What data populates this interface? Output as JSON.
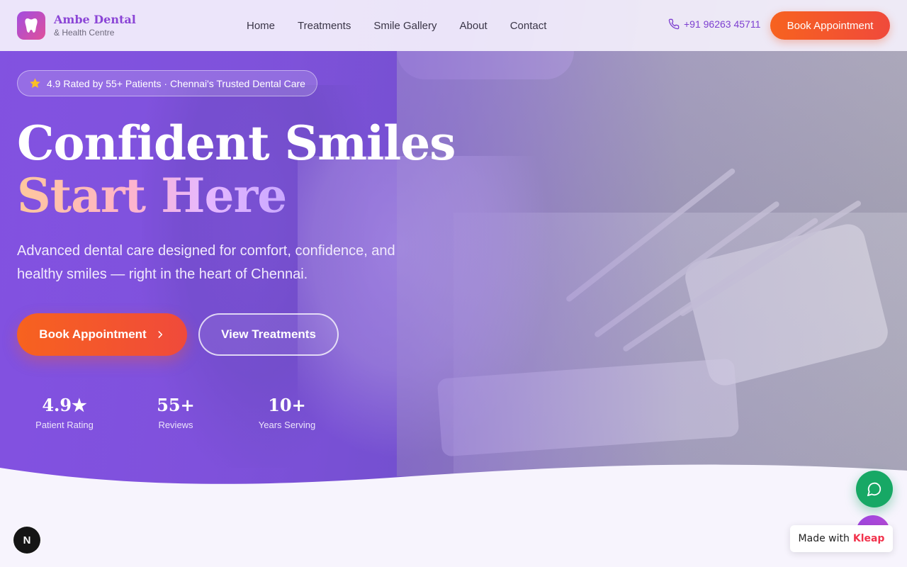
{
  "brand": {
    "name": "Ambe Dental",
    "subtitle": "& Health Centre",
    "accent": "#8b45d6",
    "cta_color": "#f7621f"
  },
  "nav": {
    "links": [
      "Home",
      "Treatments",
      "Smile Gallery",
      "About",
      "Contact"
    ],
    "phone": "+91 96263 45711",
    "cta": "Book Appointment"
  },
  "hero": {
    "rating_pill": "4.9 Rated by 55+ Patients · Chennai's Trusted Dental Care",
    "headline_line1": "Confident Smiles",
    "headline_line2": "Start Here",
    "lead": "Advanced dental care designed for comfort, confidence, and healthy smiles — right in the heart of Chennai.",
    "primary_cta": "Book Appointment",
    "secondary_cta": "View Treatments",
    "stats": [
      {
        "value": "4.9★",
        "label": "Patient Rating"
      },
      {
        "value": "55+",
        "label": "Reviews"
      },
      {
        "value": "10+",
        "label": "Years Serving"
      }
    ]
  },
  "floating": {
    "badge_text": "Made with",
    "badge_brand": "Kleap",
    "corner_badge": "N"
  },
  "icons": {
    "logo": "tooth-icon",
    "phone": "phone-icon",
    "star": "star-icon",
    "arrow": "chevron-right-icon",
    "chat": "chat-bubble-icon"
  }
}
